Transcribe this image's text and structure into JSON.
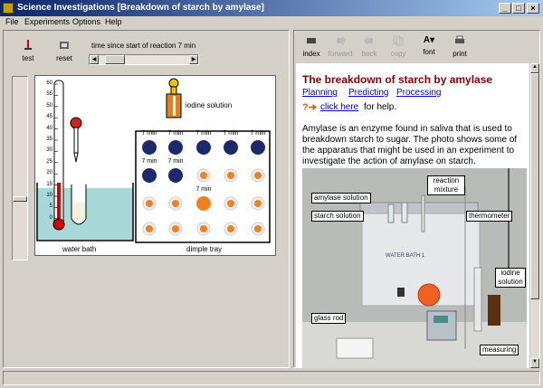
{
  "window": {
    "title": "Science Investigations [Breakdown of starch by amylase]"
  },
  "menu": {
    "items": [
      "File",
      "Experiments",
      "Options",
      "Help"
    ]
  },
  "left": {
    "test_label": "test",
    "reset_label": "reset",
    "time_label": "time since start of reaction 7 min",
    "time_minutes": 7,
    "water_bath_label": "water bath",
    "dimple_tray_label": "dimple tray",
    "iodine_label": "iodine solution",
    "thermometer_ticks": [
      "60",
      "55",
      "50",
      "45",
      "40",
      "35",
      "30",
      "25",
      "20",
      "15",
      "10",
      "5",
      "0"
    ],
    "tray_labels": [
      "7 min",
      "7 min",
      "7 min",
      "7 min",
      "7 min",
      "7 min",
      "7 min",
      "7 min"
    ]
  },
  "right": {
    "toolbar": {
      "index": "index",
      "forward": "forward",
      "back": "back",
      "copy": "copy",
      "font": "font",
      "print": "print"
    },
    "heading": "The breakdown of starch by amylase",
    "links": [
      "Planning",
      "Predicting",
      "Processing"
    ],
    "help_link": "click here",
    "help_suffix": "for help.",
    "paragraph": "Amylase is an enzyme found in saliva that is used to breakdown starch to sugar. The photo shows some of the apparatus that might be used in an experiment to investigate the action of amylase on starch.",
    "photo_labels": {
      "reaction_mixture": "reaction mixture",
      "amylase_solution": "amylase solution",
      "starch_solution": "starch solution",
      "thermometer": "thermometer",
      "iodine_solution": "iodine solution",
      "glass_rod": "glass rod",
      "measuring": "measuring",
      "water_bath_text": "WATER BATH 1"
    }
  },
  "colors": {
    "titlebar": "#0a246a",
    "heading": "#8b0000",
    "link": "#0000cc",
    "dark_dot": "#1a2a6c",
    "orange_dot": "#f08020",
    "water": "#a8d8d8"
  }
}
